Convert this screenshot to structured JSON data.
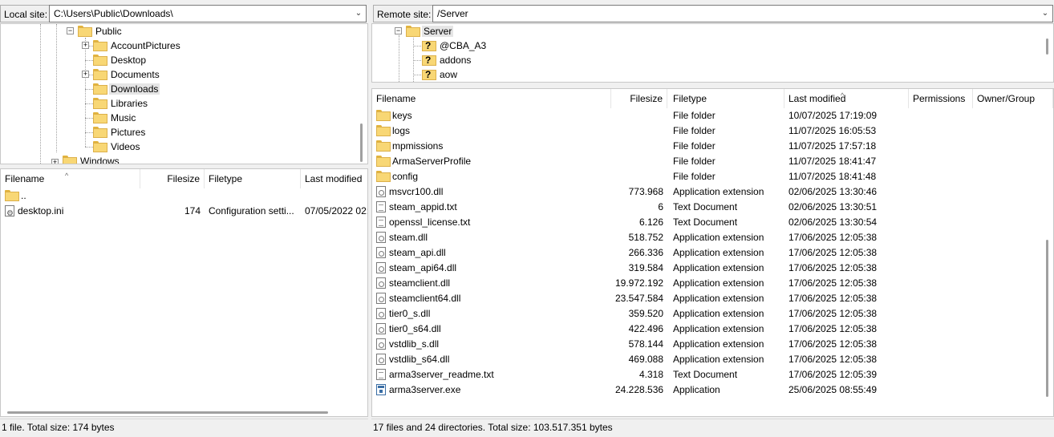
{
  "local": {
    "site_label": "Local site:",
    "path": "C:\\Users\\Public\\Downloads\\",
    "tree": {
      "root": "Public",
      "children": [
        "AccountPictures",
        "Desktop",
        "Documents",
        "Downloads",
        "Libraries",
        "Music",
        "Pictures",
        "Videos"
      ],
      "sibling": "Windows",
      "selected": "Downloads"
    },
    "columns": [
      "Filename",
      "Filesize",
      "Filetype",
      "Last modified"
    ],
    "rows": [
      {
        "name": "..",
        "size": "",
        "type": "",
        "modified": "",
        "icon": "folder-icon"
      },
      {
        "name": "desktop.ini",
        "size": "174",
        "type": "Configuration setti...",
        "modified": "07/05/2022 02:",
        "icon": "ini-file-icon"
      }
    ],
    "status": "1 file. Total size: 174 bytes"
  },
  "remote": {
    "site_label": "Remote site:",
    "path": "/Server",
    "tree": {
      "root": "Server",
      "children": [
        "@CBA_A3",
        "addons",
        "aow"
      ]
    },
    "columns": [
      "Filename",
      "Filesize",
      "Filetype",
      "Last modified",
      "Permissions",
      "Owner/Group"
    ],
    "rows": [
      {
        "name": "keys",
        "size": "",
        "type": "File folder",
        "modified": "10/07/2025 17:19:09",
        "icon": "folder"
      },
      {
        "name": "logs",
        "size": "",
        "type": "File folder",
        "modified": "11/07/2025 16:05:53",
        "icon": "folder"
      },
      {
        "name": "mpmissions",
        "size": "",
        "type": "File folder",
        "modified": "11/07/2025 17:57:18",
        "icon": "folder"
      },
      {
        "name": "ArmaServerProfile",
        "size": "",
        "type": "File folder",
        "modified": "11/07/2025 18:41:47",
        "icon": "folder"
      },
      {
        "name": "config",
        "size": "",
        "type": "File folder",
        "modified": "11/07/2025 18:41:48",
        "icon": "folder"
      },
      {
        "name": "msvcr100.dll",
        "size": "773.968",
        "type": "Application extension",
        "modified": "02/06/2025 13:30:46",
        "icon": "dll"
      },
      {
        "name": "steam_appid.txt",
        "size": "6",
        "type": "Text Document",
        "modified": "02/06/2025 13:30:51",
        "icon": "text"
      },
      {
        "name": "openssl_license.txt",
        "size": "6.126",
        "type": "Text Document",
        "modified": "02/06/2025 13:30:54",
        "icon": "text"
      },
      {
        "name": "steam.dll",
        "size": "518.752",
        "type": "Application extension",
        "modified": "17/06/2025 12:05:38",
        "icon": "dll"
      },
      {
        "name": "steam_api.dll",
        "size": "266.336",
        "type": "Application extension",
        "modified": "17/06/2025 12:05:38",
        "icon": "dll"
      },
      {
        "name": "steam_api64.dll",
        "size": "319.584",
        "type": "Application extension",
        "modified": "17/06/2025 12:05:38",
        "icon": "dll"
      },
      {
        "name": "steamclient.dll",
        "size": "19.972.192",
        "type": "Application extension",
        "modified": "17/06/2025 12:05:38",
        "icon": "dll"
      },
      {
        "name": "steamclient64.dll",
        "size": "23.547.584",
        "type": "Application extension",
        "modified": "17/06/2025 12:05:38",
        "icon": "dll"
      },
      {
        "name": "tier0_s.dll",
        "size": "359.520",
        "type": "Application extension",
        "modified": "17/06/2025 12:05:38",
        "icon": "dll"
      },
      {
        "name": "tier0_s64.dll",
        "size": "422.496",
        "type": "Application extension",
        "modified": "17/06/2025 12:05:38",
        "icon": "dll"
      },
      {
        "name": "vstdlib_s.dll",
        "size": "578.144",
        "type": "Application extension",
        "modified": "17/06/2025 12:05:38",
        "icon": "dll"
      },
      {
        "name": "vstdlib_s64.dll",
        "size": "469.088",
        "type": "Application extension",
        "modified": "17/06/2025 12:05:38",
        "icon": "dll"
      },
      {
        "name": "arma3server_readme.txt",
        "size": "4.318",
        "type": "Text Document",
        "modified": "17/06/2025 12:05:39",
        "icon": "text"
      },
      {
        "name": "arma3server.exe",
        "size": "24.228.536",
        "type": "Application",
        "modified": "25/06/2025 08:55:49",
        "icon": "exe"
      }
    ],
    "status": "17 files and 24 directories. Total size: 103.517.351 bytes"
  },
  "icons": {
    "folder": "folder-icon",
    "unknown_folder": "unknown-folder-icon",
    "text": "text-file-icon",
    "dll": "dll-file-icon",
    "exe": "exe-file-icon",
    "ini": "ini-file-icon",
    "dropdown": "chevron-down-icon",
    "expand": "plus-expander-icon",
    "collapse": "minus-expander-icon"
  },
  "colors": {
    "folder": "#f8d775",
    "selection": "#e5e5e5",
    "background": "#f0f0f0"
  }
}
